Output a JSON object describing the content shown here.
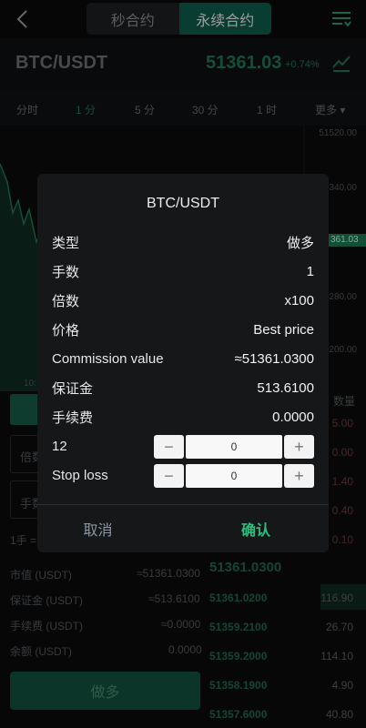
{
  "header": {
    "tabs": [
      {
        "label": "秒合约",
        "active": false
      },
      {
        "label": "永续合约",
        "active": true
      }
    ]
  },
  "ticker": {
    "pair": "BTC/USDT",
    "last_price": "51361.03",
    "change": "+0.74%"
  },
  "intervals": [
    "分时",
    "1 分",
    "5 分",
    "30 分",
    "1 时",
    "更多"
  ],
  "chart": {
    "axis_labels": [
      "51520.00",
      "340.00",
      "361.03",
      "280.00",
      "200.00"
    ],
    "x_label": "10:"
  },
  "order_book": {
    "qty_header": "数量",
    "asks_qty": [
      "5.00",
      "0.00",
      "1.40",
      "0.40",
      "0.10"
    ],
    "mid_price": "51361.0300",
    "bids": [
      {
        "price": "51361.0200",
        "qty": "116.90"
      },
      {
        "price": "51359.2100",
        "qty": "26.70"
      },
      {
        "price": "51359.2000",
        "qty": "114.10"
      },
      {
        "price": "51358.1900",
        "qty": "4.90"
      },
      {
        "price": "51357.6000",
        "qty": "40.80"
      }
    ]
  },
  "trade_panel": {
    "leverage_label": "倍数",
    "hands_label": "手数",
    "lot_hint": "1手 =",
    "summary": [
      {
        "k": "市值 (USDT)",
        "v": "≈51361.0300"
      },
      {
        "k": "保证金 (USDT)",
        "v": "≈513.6100"
      },
      {
        "k": "手续费 (USDT)",
        "v": "≈0.0000"
      },
      {
        "k": "余额 (USDT)",
        "v": "0.0000"
      }
    ],
    "submit_label": "做多"
  },
  "dialog": {
    "title": "BTC/USDT",
    "rows": [
      {
        "k": "类型",
        "v": "做多"
      },
      {
        "k": "手数",
        "v": "1"
      },
      {
        "k": "倍数",
        "v": "x100"
      },
      {
        "k": "价格",
        "v": "Best price"
      },
      {
        "k": "Commission value",
        "v": "≈51361.0300"
      },
      {
        "k": "保证金",
        "v": "513.6100"
      },
      {
        "k": "手续费",
        "v": "0.0000"
      }
    ],
    "take_profit_label": "12",
    "take_profit_value": "0",
    "stop_loss_label": "Stop loss",
    "stop_loss_value": "0",
    "minus": "−",
    "plus": "+",
    "cancel_label": "取消",
    "confirm_label": "确认"
  },
  "colors": {
    "accent": "#1e7a55",
    "confirm": "#2bbf7f",
    "tab_active": "#0f5e4d"
  }
}
